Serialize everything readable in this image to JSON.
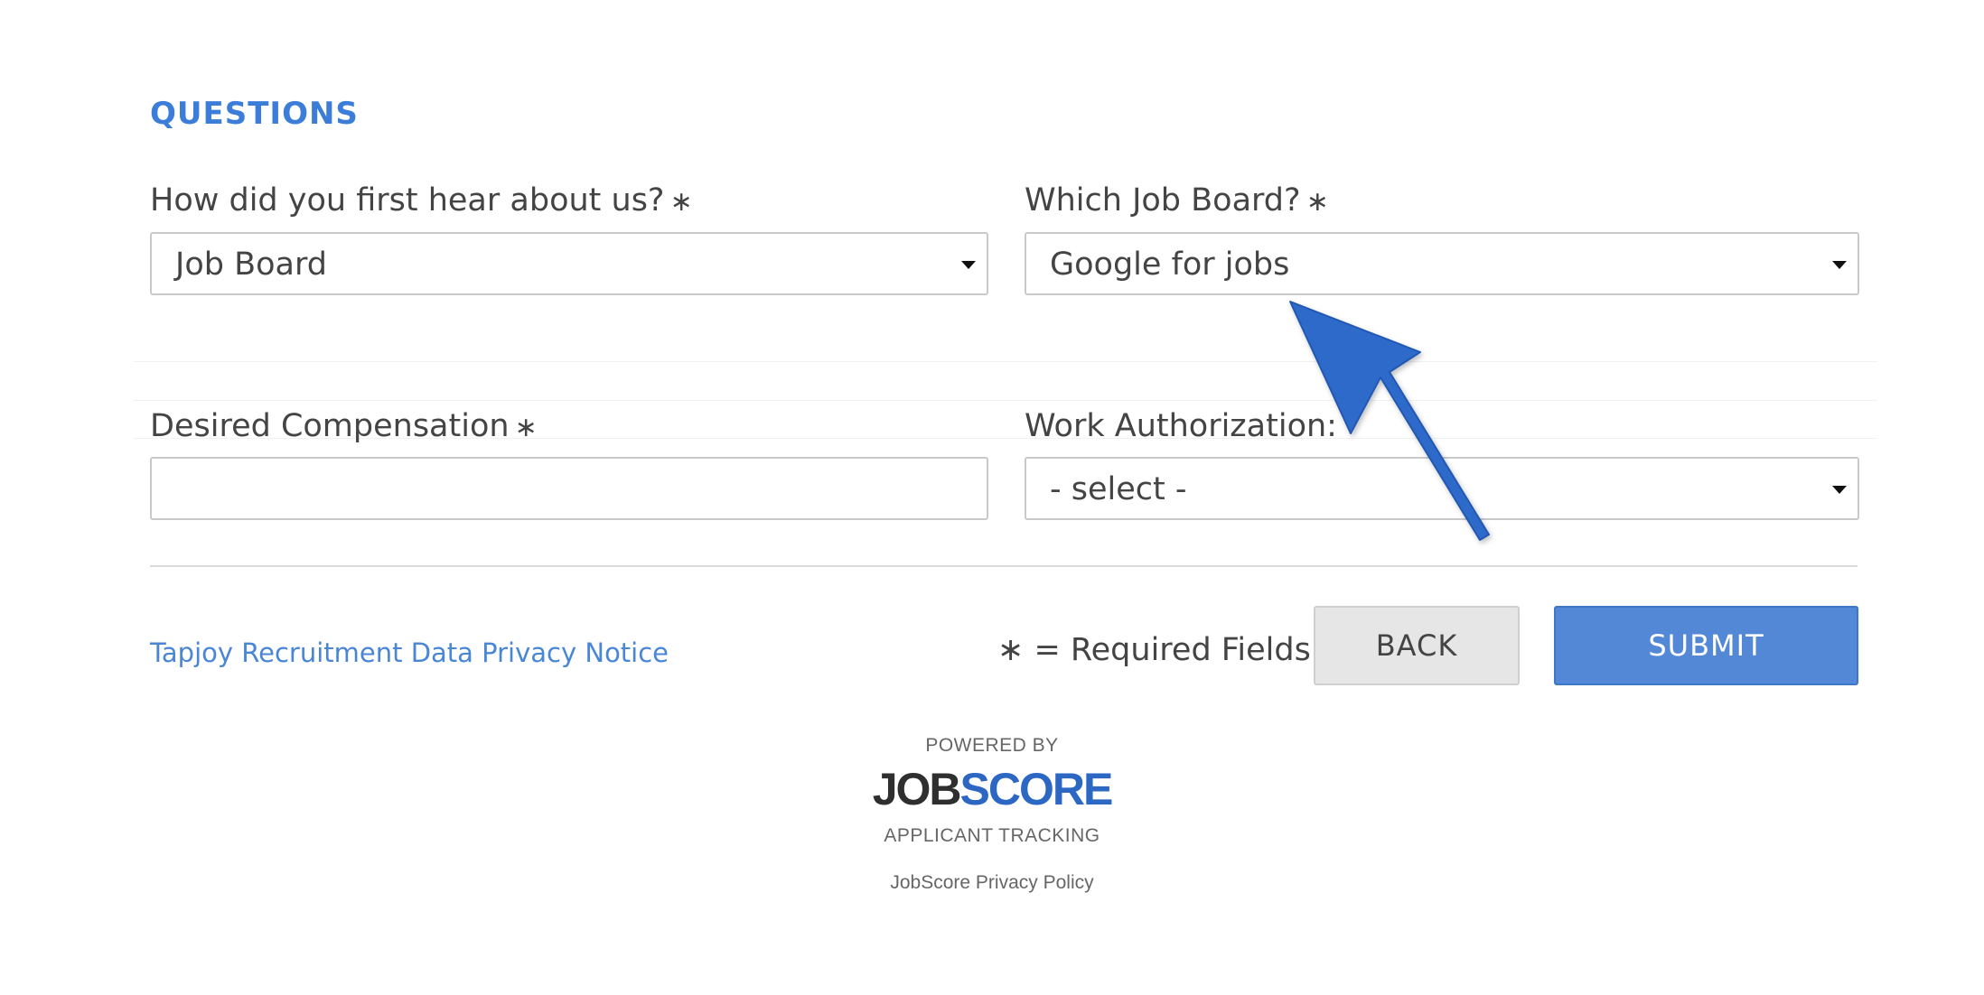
{
  "section": {
    "title": "QUESTIONS"
  },
  "fields": {
    "hear_about": {
      "label": "How did you first hear about us?",
      "required_mark": "∗",
      "value": "Job Board"
    },
    "job_board": {
      "label": "Which Job Board?",
      "required_mark": "∗",
      "value": "Google for jobs"
    },
    "compensation": {
      "label": "Desired Compensation",
      "required_mark": "∗",
      "value": ""
    },
    "work_auth": {
      "label": "Work Authorization:",
      "value": "- select -"
    }
  },
  "footer_bar": {
    "privacy_link": "Tapjoy Recruitment Data Privacy Notice",
    "required_note": "∗ = Required Fields",
    "back_label": "BACK",
    "submit_label": "SUBMIT"
  },
  "powered": {
    "powered_by": "POWERED BY",
    "logo_job": "JOB",
    "logo_score": "SCORE",
    "tagline": "APPLICANT TRACKING",
    "privacy_policy": "JobScore Privacy Policy"
  },
  "icons": {
    "dropdown": "chevron-down-icon",
    "annotation": "arrow-pointer-icon"
  },
  "colors": {
    "accent": "#3b7dd8",
    "submit": "#5388d6",
    "arrow": "#2d6bc9",
    "logo_blue": "#2d67c4"
  }
}
